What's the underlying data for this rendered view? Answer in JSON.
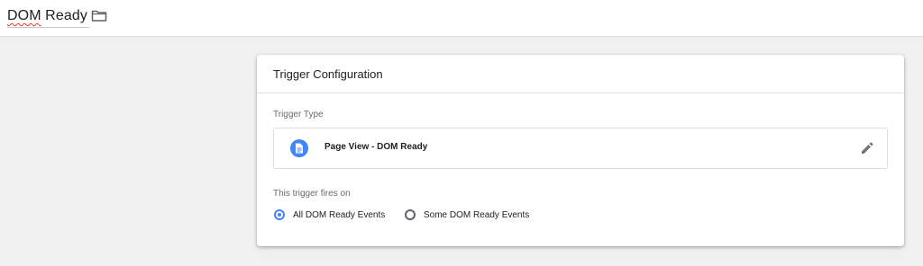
{
  "header": {
    "title_prefix": "DOM",
    "title_suffix": " Ready",
    "folder_icon": "folder-icon"
  },
  "card": {
    "title": "Trigger Configuration",
    "trigger_type_label": "Trigger Type",
    "trigger_type": {
      "icon": "document-icon",
      "icon_color": "#4285f4",
      "name": "Page View - DOM Ready",
      "edit_icon": "pencil-icon"
    },
    "fires_on_label": "This trigger fires on",
    "fires_on_options": [
      {
        "label": "All DOM Ready Events",
        "selected": true
      },
      {
        "label": "Some DOM Ready Events",
        "selected": false
      }
    ]
  },
  "colors": {
    "accent": "#4285f4",
    "background": "#f0f0f0",
    "spellcheck_underline": "#e53935"
  }
}
